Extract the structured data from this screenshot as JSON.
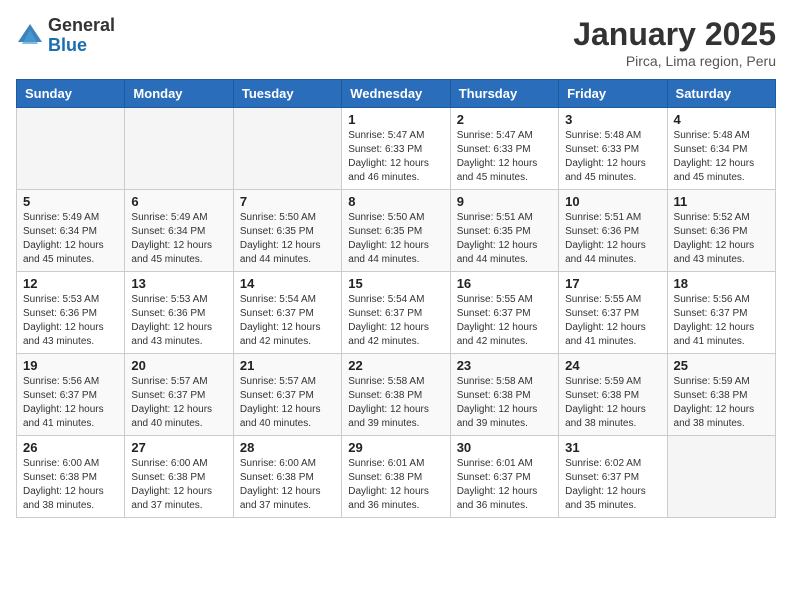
{
  "header": {
    "logo_general": "General",
    "logo_blue": "Blue",
    "title": "January 2025",
    "subtitle": "Pirca, Lima region, Peru"
  },
  "weekdays": [
    "Sunday",
    "Monday",
    "Tuesday",
    "Wednesday",
    "Thursday",
    "Friday",
    "Saturday"
  ],
  "weeks": [
    [
      {
        "day": "",
        "sunrise": "",
        "sunset": "",
        "daylight": ""
      },
      {
        "day": "",
        "sunrise": "",
        "sunset": "",
        "daylight": ""
      },
      {
        "day": "",
        "sunrise": "",
        "sunset": "",
        "daylight": ""
      },
      {
        "day": "1",
        "sunrise": "Sunrise: 5:47 AM",
        "sunset": "Sunset: 6:33 PM",
        "daylight": "Daylight: 12 hours and 46 minutes."
      },
      {
        "day": "2",
        "sunrise": "Sunrise: 5:47 AM",
        "sunset": "Sunset: 6:33 PM",
        "daylight": "Daylight: 12 hours and 45 minutes."
      },
      {
        "day": "3",
        "sunrise": "Sunrise: 5:48 AM",
        "sunset": "Sunset: 6:33 PM",
        "daylight": "Daylight: 12 hours and 45 minutes."
      },
      {
        "day": "4",
        "sunrise": "Sunrise: 5:48 AM",
        "sunset": "Sunset: 6:34 PM",
        "daylight": "Daylight: 12 hours and 45 minutes."
      }
    ],
    [
      {
        "day": "5",
        "sunrise": "Sunrise: 5:49 AM",
        "sunset": "Sunset: 6:34 PM",
        "daylight": "Daylight: 12 hours and 45 minutes."
      },
      {
        "day": "6",
        "sunrise": "Sunrise: 5:49 AM",
        "sunset": "Sunset: 6:34 PM",
        "daylight": "Daylight: 12 hours and 45 minutes."
      },
      {
        "day": "7",
        "sunrise": "Sunrise: 5:50 AM",
        "sunset": "Sunset: 6:35 PM",
        "daylight": "Daylight: 12 hours and 44 minutes."
      },
      {
        "day": "8",
        "sunrise": "Sunrise: 5:50 AM",
        "sunset": "Sunset: 6:35 PM",
        "daylight": "Daylight: 12 hours and 44 minutes."
      },
      {
        "day": "9",
        "sunrise": "Sunrise: 5:51 AM",
        "sunset": "Sunset: 6:35 PM",
        "daylight": "Daylight: 12 hours and 44 minutes."
      },
      {
        "day": "10",
        "sunrise": "Sunrise: 5:51 AM",
        "sunset": "Sunset: 6:36 PM",
        "daylight": "Daylight: 12 hours and 44 minutes."
      },
      {
        "day": "11",
        "sunrise": "Sunrise: 5:52 AM",
        "sunset": "Sunset: 6:36 PM",
        "daylight": "Daylight: 12 hours and 43 minutes."
      }
    ],
    [
      {
        "day": "12",
        "sunrise": "Sunrise: 5:53 AM",
        "sunset": "Sunset: 6:36 PM",
        "daylight": "Daylight: 12 hours and 43 minutes."
      },
      {
        "day": "13",
        "sunrise": "Sunrise: 5:53 AM",
        "sunset": "Sunset: 6:36 PM",
        "daylight": "Daylight: 12 hours and 43 minutes."
      },
      {
        "day": "14",
        "sunrise": "Sunrise: 5:54 AM",
        "sunset": "Sunset: 6:37 PM",
        "daylight": "Daylight: 12 hours and 42 minutes."
      },
      {
        "day": "15",
        "sunrise": "Sunrise: 5:54 AM",
        "sunset": "Sunset: 6:37 PM",
        "daylight": "Daylight: 12 hours and 42 minutes."
      },
      {
        "day": "16",
        "sunrise": "Sunrise: 5:55 AM",
        "sunset": "Sunset: 6:37 PM",
        "daylight": "Daylight: 12 hours and 42 minutes."
      },
      {
        "day": "17",
        "sunrise": "Sunrise: 5:55 AM",
        "sunset": "Sunset: 6:37 PM",
        "daylight": "Daylight: 12 hours and 41 minutes."
      },
      {
        "day": "18",
        "sunrise": "Sunrise: 5:56 AM",
        "sunset": "Sunset: 6:37 PM",
        "daylight": "Daylight: 12 hours and 41 minutes."
      }
    ],
    [
      {
        "day": "19",
        "sunrise": "Sunrise: 5:56 AM",
        "sunset": "Sunset: 6:37 PM",
        "daylight": "Daylight: 12 hours and 41 minutes."
      },
      {
        "day": "20",
        "sunrise": "Sunrise: 5:57 AM",
        "sunset": "Sunset: 6:37 PM",
        "daylight": "Daylight: 12 hours and 40 minutes."
      },
      {
        "day": "21",
        "sunrise": "Sunrise: 5:57 AM",
        "sunset": "Sunset: 6:37 PM",
        "daylight": "Daylight: 12 hours and 40 minutes."
      },
      {
        "day": "22",
        "sunrise": "Sunrise: 5:58 AM",
        "sunset": "Sunset: 6:38 PM",
        "daylight": "Daylight: 12 hours and 39 minutes."
      },
      {
        "day": "23",
        "sunrise": "Sunrise: 5:58 AM",
        "sunset": "Sunset: 6:38 PM",
        "daylight": "Daylight: 12 hours and 39 minutes."
      },
      {
        "day": "24",
        "sunrise": "Sunrise: 5:59 AM",
        "sunset": "Sunset: 6:38 PM",
        "daylight": "Daylight: 12 hours and 38 minutes."
      },
      {
        "day": "25",
        "sunrise": "Sunrise: 5:59 AM",
        "sunset": "Sunset: 6:38 PM",
        "daylight": "Daylight: 12 hours and 38 minutes."
      }
    ],
    [
      {
        "day": "26",
        "sunrise": "Sunrise: 6:00 AM",
        "sunset": "Sunset: 6:38 PM",
        "daylight": "Daylight: 12 hours and 38 minutes."
      },
      {
        "day": "27",
        "sunrise": "Sunrise: 6:00 AM",
        "sunset": "Sunset: 6:38 PM",
        "daylight": "Daylight: 12 hours and 37 minutes."
      },
      {
        "day": "28",
        "sunrise": "Sunrise: 6:00 AM",
        "sunset": "Sunset: 6:38 PM",
        "daylight": "Daylight: 12 hours and 37 minutes."
      },
      {
        "day": "29",
        "sunrise": "Sunrise: 6:01 AM",
        "sunset": "Sunset: 6:38 PM",
        "daylight": "Daylight: 12 hours and 36 minutes."
      },
      {
        "day": "30",
        "sunrise": "Sunrise: 6:01 AM",
        "sunset": "Sunset: 6:37 PM",
        "daylight": "Daylight: 12 hours and 36 minutes."
      },
      {
        "day": "31",
        "sunrise": "Sunrise: 6:02 AM",
        "sunset": "Sunset: 6:37 PM",
        "daylight": "Daylight: 12 hours and 35 minutes."
      },
      {
        "day": "",
        "sunrise": "",
        "sunset": "",
        "daylight": ""
      }
    ]
  ]
}
